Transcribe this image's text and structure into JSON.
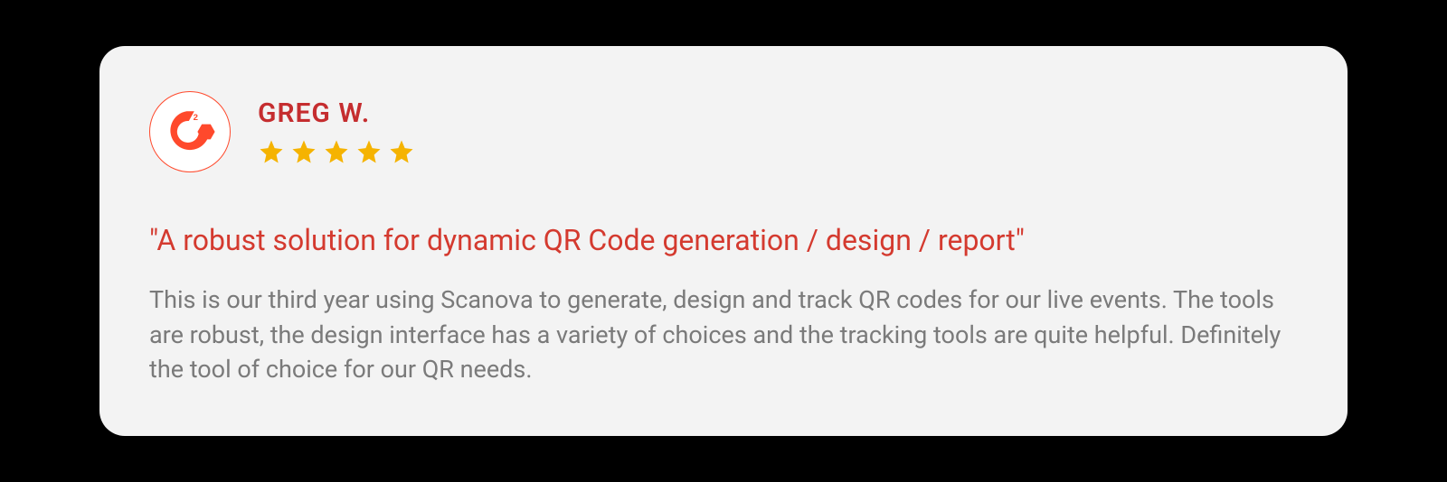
{
  "reviewer": {
    "name": "GREG W.",
    "rating": 5
  },
  "review": {
    "headline": "\"A robust solution for dynamic QR Code generation / design / report\"",
    "body": "This is our third year using Scanova to generate, design and track QR codes for our live events. The tools are robust, the design interface has a variety of choices and the tracking tools are quite helpful. Definitely the tool of choice for our QR needs."
  },
  "colors": {
    "accent": "#ff492c",
    "headline": "#d43a2f",
    "name": "#c52d2f",
    "star": "#f5b301",
    "body": "#7a7a7a",
    "card": "#f3f3f3"
  }
}
